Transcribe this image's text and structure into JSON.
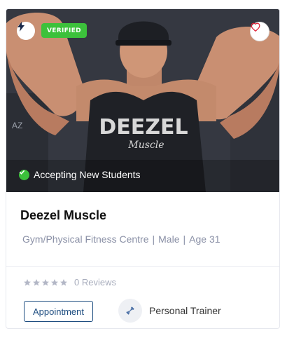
{
  "badges": {
    "verified_label": "VERIFIED",
    "bolt_icon": "lightning-bolt-icon",
    "favorite_icon": "heart-icon"
  },
  "hero": {
    "status_text": "Accepting New Students",
    "status_icon": "check-circle-icon",
    "shirt_text_main": "DEEZEL",
    "shirt_text_script": "Muscle"
  },
  "profile": {
    "name": "Deezel Muscle",
    "business_type": "Gym/Physical Fitness Centre",
    "gender": "Male",
    "age": "Age 31",
    "separator": "|"
  },
  "rating": {
    "stars": 0,
    "max_stars": 5,
    "reviews_text": "0 Reviews"
  },
  "actions": {
    "appointment_label": "Appointment",
    "category_label": "Personal Trainer",
    "category_icon": "dumbbell-icon"
  },
  "colors": {
    "verified_green": "#3cc13b",
    "primary_blue": "#1e4d80",
    "muted_text": "#8a90a6",
    "heart_red": "#e0243a"
  }
}
